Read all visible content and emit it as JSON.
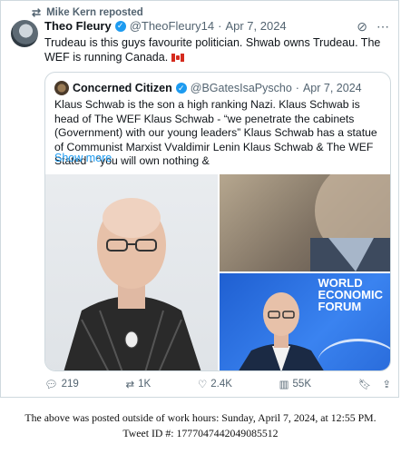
{
  "repost": {
    "icon": "repost-icon",
    "text": "Mike Kern reposted"
  },
  "tweet": {
    "author": "Theo Fleury",
    "handle": "@TheoFleury14",
    "dot": "·",
    "date": "Apr 7, 2024",
    "text": "Trudeau is this guys favourite politician. Shwab owns Trudeau. The WEF is running Canada.",
    "flag": "canada-flag-icon"
  },
  "quote": {
    "author": "Concerned Citizen",
    "handle": "@BGatesIsaPyscho",
    "dot": "·",
    "date": "Apr 7, 2024",
    "text": "Klaus Schwab is the son a high ranking Nazi. Klaus Schwab is head of The WEF Klaus Schwab - “we penetrate the cabinets (Government) with our young leaders” Klaus Schwab has a statue of Communist Marxist Vvaldimir Lenin Klaus Schwab & The WEF Stated - “you will own nothing &",
    "show_more": "Show more",
    "wef_logo": [
      "WORLD",
      "ECONOMIC",
      "FORUM"
    ]
  },
  "actions": {
    "replies": "219",
    "reposts": "1K",
    "likes": "2.4K",
    "views": "55K"
  },
  "footer": {
    "line1": "The above was posted outside of work hours: Sunday, April 7, 2024, at 12:55 PM.",
    "line2": "Tweet ID #: 1777047442049085512"
  }
}
